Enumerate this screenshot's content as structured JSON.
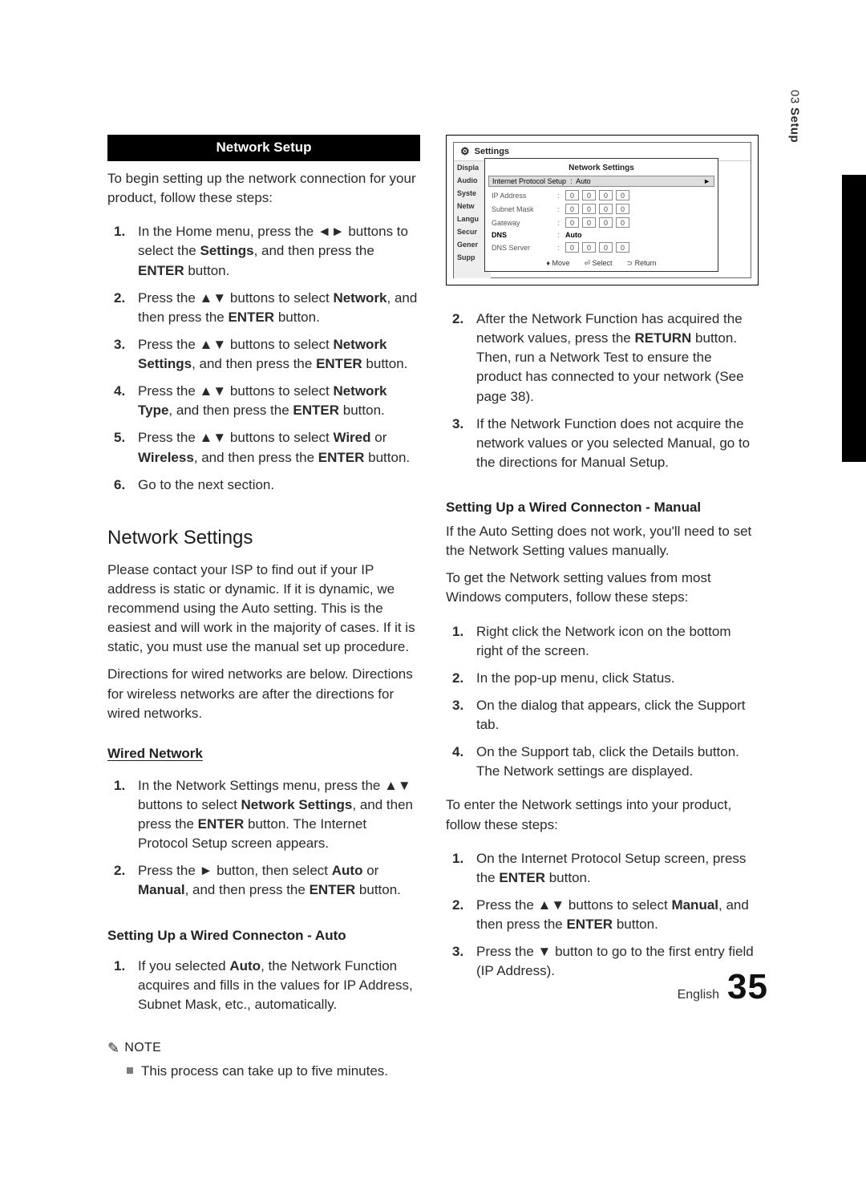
{
  "side_tab": {
    "chapter": "03",
    "title": "Setup"
  },
  "left": {
    "heading": "Network Setup",
    "intro": "To begin setting up the network connection for your product, follow these steps:",
    "steps": [
      "In the Home menu, press the ◄► buttons to select the <strong>Settings</strong>, and then press the <strong>ENTER</strong> button.",
      "Press the ▲▼ buttons to select <strong>Network</strong>, and then press the <strong>ENTER</strong> button.",
      "Press the ▲▼ buttons to select <strong>Network Settings</strong>, and then press the <strong>ENTER</strong> button.",
      "Press the ▲▼ buttons to select <strong>Network Type</strong>, and then press the <strong>ENTER</strong> button.",
      "Press the ▲▼ buttons to select <strong>Wired</strong> or <strong>Wireless</strong>, and then press the <strong>ENTER</strong> button.",
      "Go to the next section."
    ],
    "section2": "Network Settings",
    "para1": "Please contact your ISP to find out if your IP address is static or dynamic. If it is dynamic, we recommend using the Auto setting. This is the easiest and will work in the majority of cases. If it is static, you must use the manual set up procedure.",
    "para2": "Directions for wired networks are below. Directions for wireless networks are after the directions for wired networks.",
    "wired_title": "Wired Network",
    "wired_steps": [
      "In the Network Settings menu, press the ▲▼ buttons to select <strong>Network Settings</strong>, and then press the <strong>ENTER</strong> button. The Internet Protocol Setup screen appears.",
      "Press the ► button, then select <strong>Auto</strong> or <strong>Manual</strong>, and then press the <strong>ENTER</strong> button."
    ],
    "auto_title": "Setting Up a Wired Connecton - Auto",
    "auto_steps": [
      "If you selected <strong>Auto</strong>, the Network Function acquires and fills in the values for IP Address, Subnet Mask, etc., automatically."
    ],
    "note_label": "NOTE",
    "note_text": "This process can take up to five minutes."
  },
  "screenshot": {
    "app_title": "Settings",
    "panel_title": "Network Settings",
    "selected_row": {
      "label": "Internet Protocol Setup",
      "value": "Auto"
    },
    "side_items": [
      "Displa",
      "Audio",
      "Syste",
      "Netw",
      "Langu",
      "Secur",
      "Gener",
      "Supp"
    ],
    "rows": [
      {
        "label": "IP Address",
        "ip": [
          "0",
          "0",
          "0",
          "0"
        ]
      },
      {
        "label": "Subnet Mask",
        "ip": [
          "0",
          "0",
          "0",
          "0"
        ]
      },
      {
        "label": "Gateway",
        "ip": [
          "0",
          "0",
          "0",
          "0"
        ]
      }
    ],
    "dns_label": "DNS",
    "dns_value": "Auto",
    "dns_server": {
      "label": "DNS Server",
      "ip": [
        "0",
        "0",
        "0",
        "0"
      ]
    },
    "legend": {
      "move": "Move",
      "select": "Select",
      "ret": "Return"
    }
  },
  "right": {
    "steps_after_screenshot": [
      {
        "n": "2.",
        "t": "After the Network Function has acquired the network values, press the <strong>RETURN</strong> button. Then, run a Network Test to ensure the product has connected to your network (See page 38)."
      },
      {
        "n": "3.",
        "t": "If the Network Function does not acquire the network values or you selected Manual, go to the directions for Manual Setup."
      }
    ],
    "manual_title": "Setting Up a Wired Connecton - Manual",
    "manual_p1": "If the Auto Setting does not work, you'll need to set the Network Setting values manually.",
    "manual_p2": "To get the Network setting values from most Windows computers, follow these steps:",
    "manual_steps": [
      "Right click the Network icon on the bottom right of the screen.",
      "In the pop-up menu, click Status.",
      "On the dialog that appears, click the Support tab.",
      "On the Support tab, click the Details button. The Network settings are displayed."
    ],
    "enter_p": "To enter the Network settings into your product, follow these steps:",
    "enter_steps": [
      "On the Internet Protocol Setup screen, press the <strong>ENTER</strong> button.",
      "Press the ▲▼ buttons to select <strong>Manual</strong>, and then press the <strong>ENTER</strong> button.",
      "Press the ▼ button to go to the first entry field (IP Address)."
    ]
  },
  "footer": {
    "lang": "English",
    "page": "35"
  }
}
